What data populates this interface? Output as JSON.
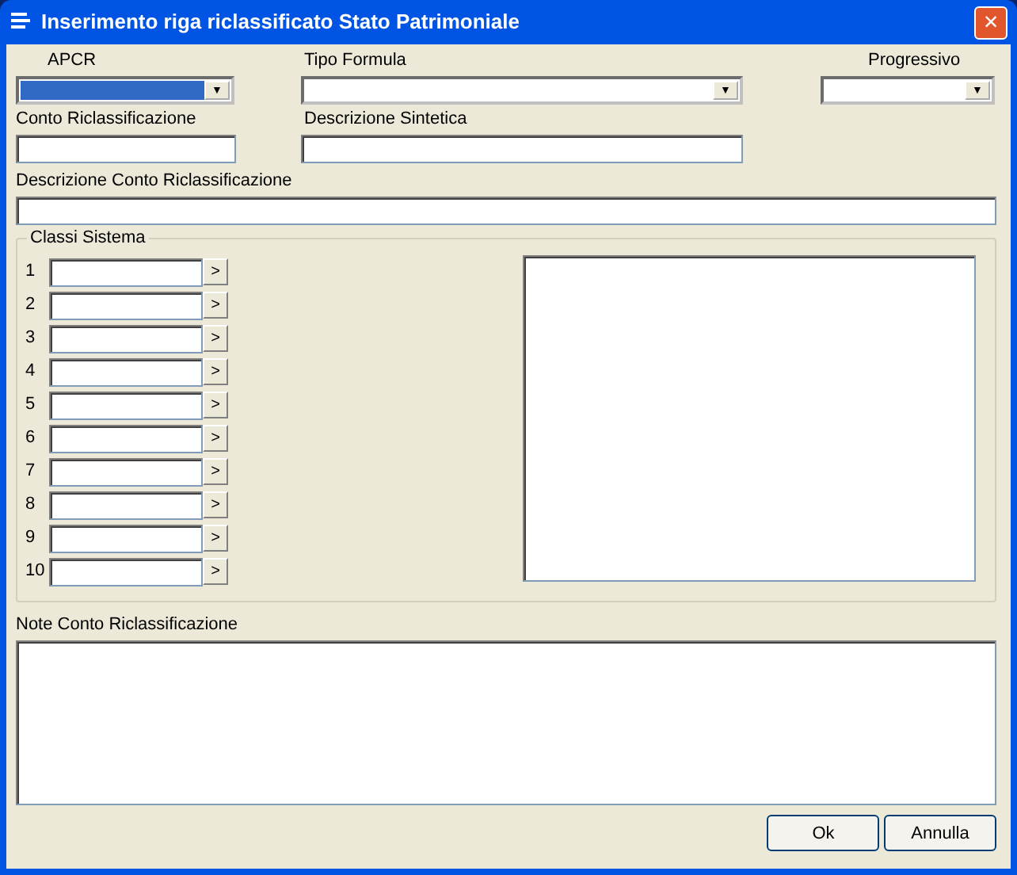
{
  "window": {
    "title": "Inserimento riga riclassificato Stato Patrimoniale",
    "close": "×"
  },
  "combos": [
    {
      "label": "APCR",
      "focused": true,
      "arrow": "▼"
    },
    {
      "label": "Tipo Formula",
      "focused": false,
      "arrow": "▼"
    },
    {
      "label": "Progressivo",
      "focused": false,
      "arrow": "▼"
    }
  ],
  "fields": [
    {
      "label": "Conto Riclassificazione"
    },
    {
      "label": "Descrizione Sintetica"
    },
    {
      "label": "Descrizione Conto Riclassificazione"
    }
  ],
  "classi_sistema": {
    "title": "Classi Sistema",
    "rows": [
      {
        "number": "1",
        "button": ">"
      },
      {
        "number": "2",
        "button": ">"
      },
      {
        "number": "3",
        "button": ">"
      },
      {
        "number": "4",
        "button": ">"
      },
      {
        "number": "5",
        "button": ">"
      },
      {
        "number": "6",
        "button": ">"
      },
      {
        "number": "7",
        "button": ">"
      },
      {
        "number": "8",
        "button": ">"
      },
      {
        "number": "9",
        "button": ">"
      },
      {
        "number": "10",
        "button": ">"
      }
    ]
  },
  "note": {
    "label": "Note Conto Riclassificazione"
  },
  "buttons": [
    "Ok",
    "Annulla"
  ]
}
